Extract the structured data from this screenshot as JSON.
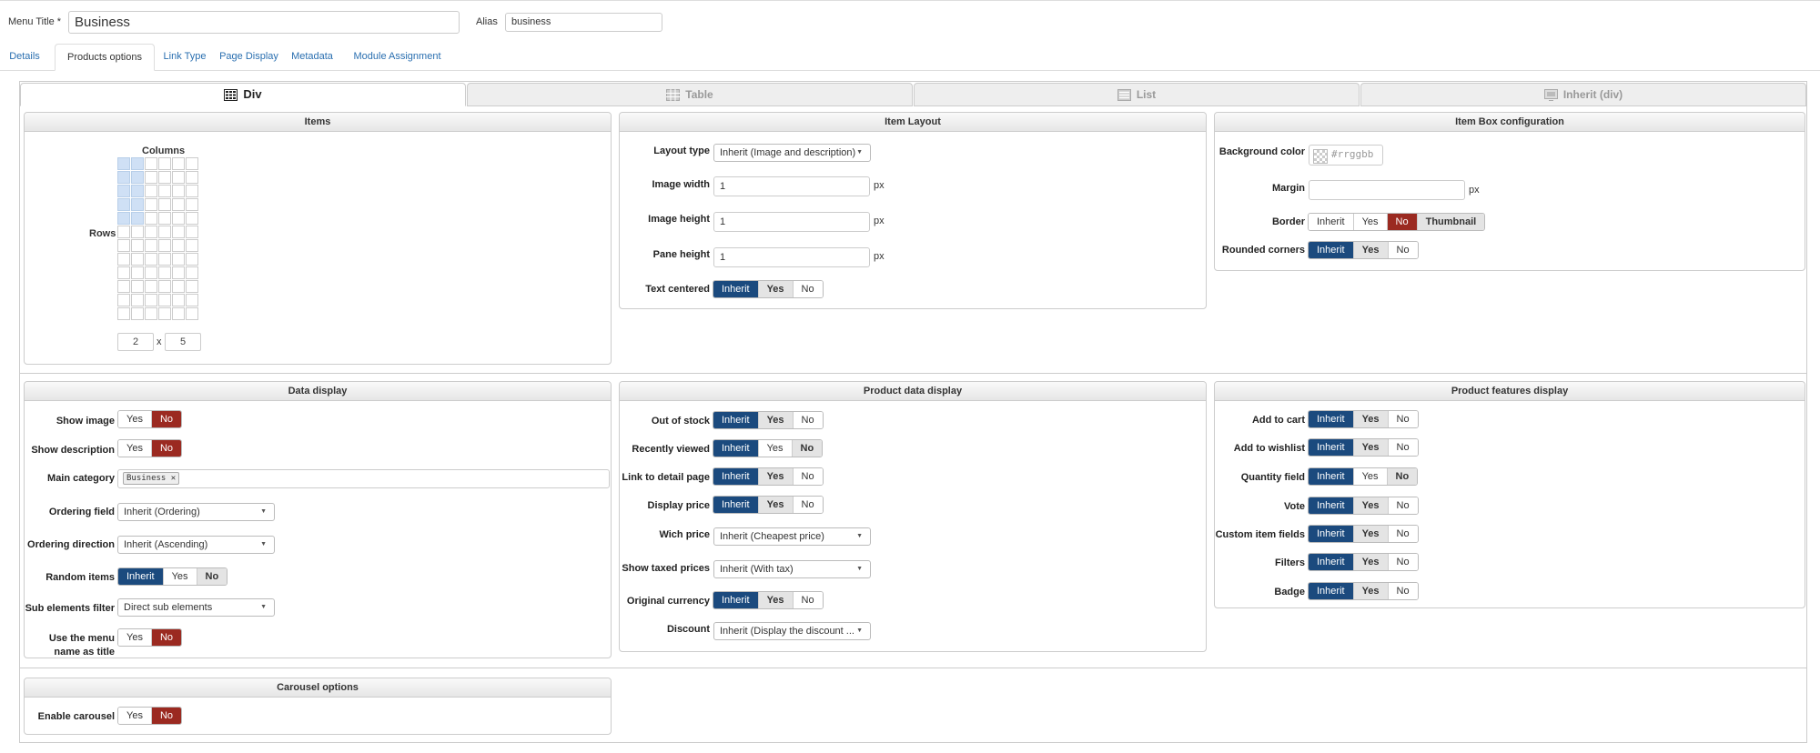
{
  "menu_title": {
    "label": "Menu Title *",
    "value": "Business"
  },
  "alias": {
    "label": "Alias",
    "value": "business"
  },
  "tabs": [
    "Details",
    "Products options",
    "Link Type",
    "Page Display",
    "Metadata",
    "Module Assignment"
  ],
  "layout_tabs": [
    {
      "label": "Div",
      "icon": "div-layout-icon"
    },
    {
      "label": "Table",
      "icon": "table-layout-icon"
    },
    {
      "label": "List",
      "icon": "list-layout-icon"
    },
    {
      "label": "Inherit (div)",
      "icon": "inherit-layout-icon"
    }
  ],
  "items": {
    "title": "Items",
    "columns_label": "Columns",
    "rows_label": "Rows",
    "columns_value": "2",
    "rows_value": "5",
    "times": "x"
  },
  "item_layout": {
    "title": "Item Layout",
    "layout_type": {
      "label": "Layout type",
      "value": "Inherit (Image and description)"
    },
    "image_width": {
      "label": "Image width",
      "value": "1",
      "unit": "px"
    },
    "image_height": {
      "label": "Image height",
      "value": "1",
      "unit": "px"
    },
    "pane_height": {
      "label": "Pane height",
      "value": "1",
      "unit": "px"
    },
    "text_centered": {
      "label": "Text centered",
      "options": [
        "Inherit",
        "Yes",
        "No"
      ]
    }
  },
  "item_box": {
    "title": "Item Box configuration",
    "background_color": {
      "label": "Background color",
      "placeholder": "#rrggbb"
    },
    "margin": {
      "label": "Margin",
      "unit": "px"
    },
    "border": {
      "label": "Border",
      "options": [
        "Inherit",
        "Yes",
        "No",
        "Thumbnail"
      ]
    },
    "rounded": {
      "label": "Rounded corners",
      "options": [
        "Inherit",
        "Yes",
        "No"
      ]
    }
  },
  "data_display": {
    "title": "Data display",
    "show_image": {
      "label": "Show image",
      "options": [
        "Yes",
        "No"
      ]
    },
    "show_description": {
      "label": "Show description",
      "options": [
        "Yes",
        "No"
      ]
    },
    "main_category": {
      "label": "Main category",
      "tag": "Business"
    },
    "ordering_field": {
      "label": "Ordering field",
      "value": "Inherit (Ordering)"
    },
    "ordering_direction": {
      "label": "Ordering direction",
      "value": "Inherit (Ascending)"
    },
    "random_items": {
      "label": "Random items",
      "options": [
        "Inherit",
        "Yes",
        "No"
      ]
    },
    "sub_elements": {
      "label": "Sub elements filter",
      "value": "Direct sub elements"
    },
    "menu_name": {
      "label1": "Use the menu",
      "label2": "name as title",
      "options": [
        "Yes",
        "No"
      ]
    }
  },
  "product_data": {
    "title": "Product data display",
    "out_of_stock": {
      "label": "Out of stock",
      "options": [
        "Inherit",
        "Yes",
        "No"
      ]
    },
    "recently_viewed": {
      "label": "Recently viewed",
      "options": [
        "Inherit",
        "Yes",
        "No"
      ]
    },
    "link_detail": {
      "label": "Link to detail page",
      "options": [
        "Inherit",
        "Yes",
        "No"
      ]
    },
    "display_price": {
      "label": "Display price",
      "options": [
        "Inherit",
        "Yes",
        "No"
      ]
    },
    "wich_price": {
      "label": "Wich price",
      "value": "Inherit (Cheapest price)"
    },
    "taxed_prices": {
      "label": "Show taxed prices",
      "value": "Inherit (With tax)"
    },
    "original_currency": {
      "label": "Original currency",
      "options": [
        "Inherit",
        "Yes",
        "No"
      ]
    },
    "discount": {
      "label": "Discount",
      "value": "Inherit (Display the discount ..."
    }
  },
  "features": {
    "title": "Product features display",
    "add_to_cart": {
      "label": "Add to cart",
      "options": [
        "Inherit",
        "Yes",
        "No"
      ]
    },
    "add_to_wishlist": {
      "label": "Add to wishlist",
      "options": [
        "Inherit",
        "Yes",
        "No"
      ]
    },
    "quantity_field": {
      "label": "Quantity field",
      "options": [
        "Inherit",
        "Yes",
        "No"
      ]
    },
    "vote": {
      "label": "Vote",
      "options": [
        "Inherit",
        "Yes",
        "No"
      ]
    },
    "custom_fields": {
      "label": "Custom item fields",
      "options": [
        "Inherit",
        "Yes",
        "No"
      ]
    },
    "filters": {
      "label": "Filters",
      "options": [
        "Inherit",
        "Yes",
        "No"
      ]
    },
    "badge": {
      "label": "Badge",
      "options": [
        "Inherit",
        "Yes",
        "No"
      ]
    }
  },
  "carousel": {
    "title": "Carousel options",
    "enable": {
      "label": "Enable carousel",
      "options": [
        "Yes",
        "No"
      ]
    }
  },
  "colors": {
    "inherit_blue": "#1b4a7e",
    "no_red": "#9b2a21",
    "link_blue": "#2a6fb0"
  }
}
